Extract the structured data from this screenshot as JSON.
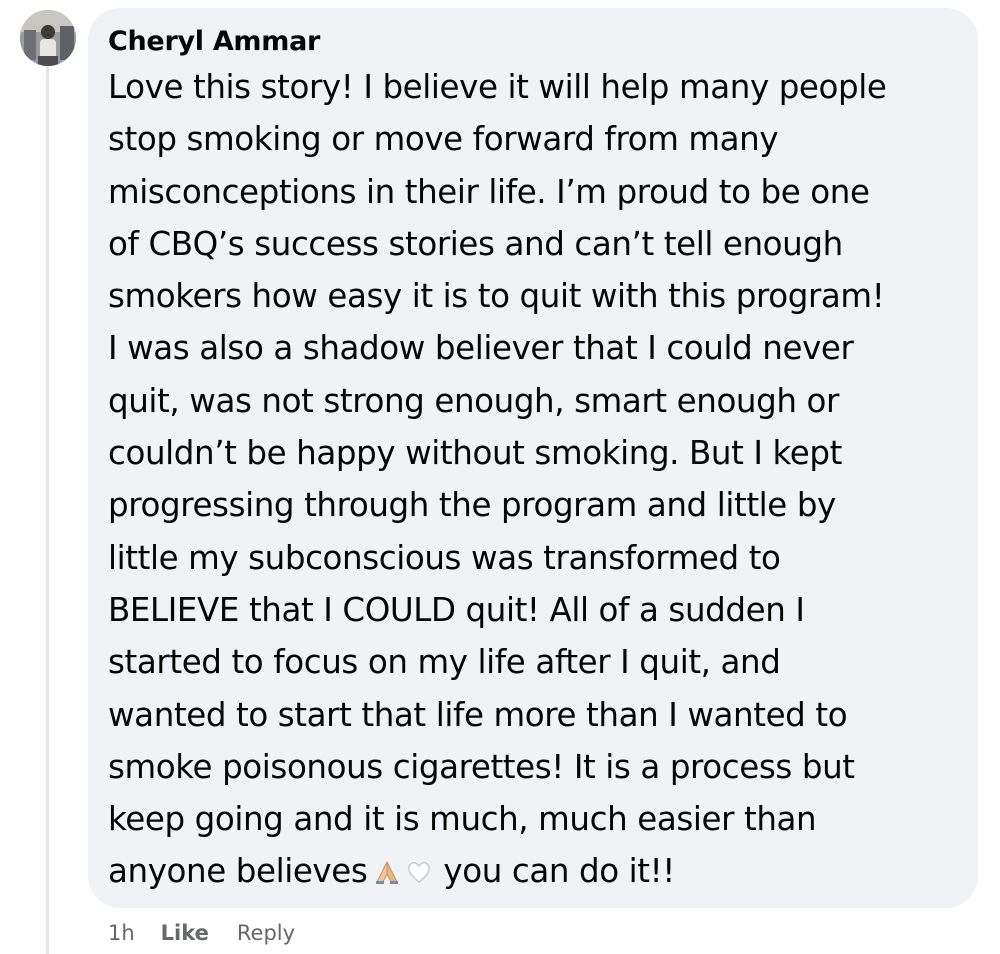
{
  "comment": {
    "author": "Cheryl Ammar",
    "lines": [
      "Love this story! I believe it will help many people",
      "stop smoking or move forward from many",
      "misconceptions in their life. I’m proud to be one",
      "of CBQ’s success stories and can’t tell enough",
      "smokers how easy it is to quit with this program!",
      "I was also a shadow believer that I could never",
      "quit, was not strong enough, smart enough or",
      "couldn’t be happy without smoking. But I kept",
      "progressing through the program and little by",
      "little my subconscious was transformed to",
      "BELIEVE that I COULD quit! All of a sudden I",
      "started to focus on my life after I quit, and",
      "wanted to start that life more than I wanted to",
      "smoke poisonous cigarettes! It is a process but",
      "keep going and it is much, much easier than"
    ],
    "last_line_before_emoji": "anyone believes",
    "last_line_after_emoji": "you can do it!!",
    "emojis": [
      "folded-hands-icon",
      "white-heart-icon"
    ]
  },
  "actions": {
    "time": "1h",
    "like_label": "Like",
    "reply_label": "Reply"
  },
  "colors": {
    "bubble": "#f0f2f5",
    "text": "#050505",
    "secondary_text": "#65676b",
    "thread_line": "#e4e6eb"
  }
}
